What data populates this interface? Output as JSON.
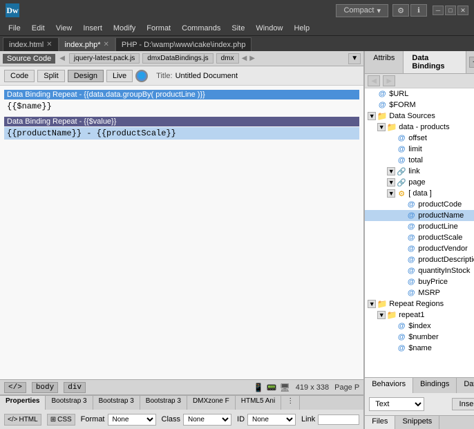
{
  "titlebar": {
    "app_name": "Dw",
    "compact_label": "Compact",
    "chevron": "▾",
    "minimize": "─",
    "maximize": "□",
    "close": "✕"
  },
  "menubar": {
    "items": [
      "File",
      "Edit",
      "View",
      "Insert",
      "Modify",
      "Format",
      "Commands",
      "Site",
      "Window",
      "Help"
    ]
  },
  "tabs": [
    {
      "label": "index.html",
      "active": false,
      "modified": false
    },
    {
      "label": "index.php*",
      "active": true,
      "modified": true
    },
    {
      "label": "PHP - D:\\wamp\\www\\cake\\index.php",
      "active": false
    }
  ],
  "source_toolbar": {
    "source_label": "Source Code",
    "files": [
      "jquery-latest.pack.js",
      "dmxDataBindings.js",
      "dmx"
    ]
  },
  "view_toolbar": {
    "code_btn": "Code",
    "split_btn": "Split",
    "design_btn": "Design",
    "live_btn": "Live",
    "title_label": "Title:",
    "title_value": "Untitled Document"
  },
  "code_editor": {
    "line1_binding": "Data Binding Repeat - {{data.data.groupBy( productLine )}}",
    "line1_code": "{{$name}}",
    "line2_binding": "Data Binding Repeat - {{$value}}",
    "line2_code": "{{productName}} - {{productScale}}"
  },
  "status_bar": {
    "tag1": "</>",
    "tag2": "body",
    "tag3": "div",
    "size": "419 x 338",
    "page_right": "Page P"
  },
  "properties": {
    "tabs": [
      "Properties",
      "Bootstrap 3",
      "Bootstrap 3",
      "Bootstrap 3",
      "DMXzone F",
      "HTML5 Ani",
      "⋮"
    ],
    "html_label": "HTML",
    "css_label": "CSS",
    "format_label": "Format",
    "format_value": "None",
    "class_label": "Class",
    "class_value": "None",
    "id_label": "ID",
    "id_value": "None",
    "link_label": "Link"
  },
  "right_panel": {
    "tabs": [
      "Attribs",
      "Data Bindings"
    ],
    "active_tab": "Data Bindings",
    "nav_back": "◀",
    "nav_forward": "▶",
    "tool_add": "+",
    "tool_remove": "─",
    "tool_refresh": "↻"
  },
  "data_tree": {
    "items": [
      {
        "level": 0,
        "expand": false,
        "type": "at",
        "label": "$URL"
      },
      {
        "level": 0,
        "expand": false,
        "type": "at",
        "label": "$FORM"
      },
      {
        "level": 0,
        "expand": true,
        "type": "folder",
        "label": "Data Sources"
      },
      {
        "level": 1,
        "expand": true,
        "type": "folder",
        "label": "data - products"
      },
      {
        "level": 2,
        "expand": false,
        "type": "at",
        "label": "offset"
      },
      {
        "level": 2,
        "expand": false,
        "type": "at",
        "label": "limit"
      },
      {
        "level": 2,
        "expand": false,
        "type": "at",
        "label": "total"
      },
      {
        "level": 2,
        "expand": true,
        "type": "link",
        "label": "link"
      },
      {
        "level": 2,
        "expand": true,
        "type": "link",
        "label": "page"
      },
      {
        "level": 2,
        "expand": true,
        "type": "data",
        "label": "[ data ]"
      },
      {
        "level": 3,
        "expand": false,
        "type": "at",
        "label": "productCode"
      },
      {
        "level": 3,
        "expand": false,
        "type": "at",
        "label": "productName",
        "selected": true
      },
      {
        "level": 3,
        "expand": false,
        "type": "at",
        "label": "productLine"
      },
      {
        "level": 3,
        "expand": false,
        "type": "at",
        "label": "productScale"
      },
      {
        "level": 3,
        "expand": false,
        "type": "at",
        "label": "productVendor"
      },
      {
        "level": 3,
        "expand": false,
        "type": "at",
        "label": "productDescription"
      },
      {
        "level": 3,
        "expand": false,
        "type": "at",
        "label": "quantityInStock"
      },
      {
        "level": 3,
        "expand": false,
        "type": "at",
        "label": "buyPrice"
      },
      {
        "level": 3,
        "expand": false,
        "type": "at",
        "label": "MSRP"
      },
      {
        "level": 0,
        "expand": true,
        "type": "folder",
        "label": "Repeat Regions"
      },
      {
        "level": 1,
        "expand": true,
        "type": "folder",
        "label": "repeat1"
      },
      {
        "level": 2,
        "expand": false,
        "type": "at",
        "label": "$index"
      },
      {
        "level": 2,
        "expand": false,
        "type": "at",
        "label": "$number"
      },
      {
        "level": 2,
        "expand": false,
        "type": "at",
        "label": "$name"
      }
    ]
  },
  "bottom_panel": {
    "tabs": [
      "Behaviors",
      "Bindings",
      "Databases"
    ],
    "text_label": "Text",
    "text_placeholder": "Text",
    "insert_btn": "Insert",
    "settings_icon": "⚙"
  },
  "files_bar": {
    "tabs": [
      "Files",
      "Snippets"
    ]
  }
}
